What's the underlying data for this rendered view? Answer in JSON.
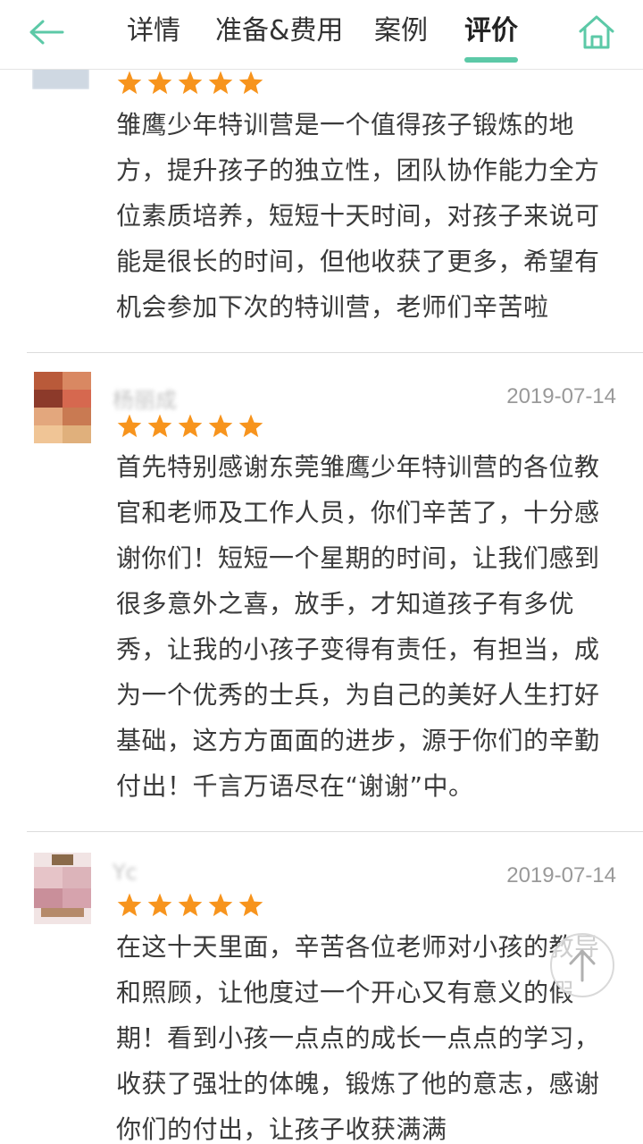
{
  "header": {
    "back_icon": "arrow-left-icon",
    "home_icon": "home-icon",
    "accent_color": "#5cc9a7",
    "tabs": [
      {
        "label": "详情",
        "active": false
      },
      {
        "label": "准备&费用",
        "active": false
      },
      {
        "label": "案例",
        "active": false
      },
      {
        "label": "评价",
        "active": true
      }
    ]
  },
  "reviews": [
    {
      "username": "",
      "date": "",
      "rating": 5,
      "text": "雏鹰少年特训营是一个值得孩子锻炼的地方，提升孩子的独立性，团队协作能力全方位素质培养，短短十天时间，对孩子来说可能是很长的时间，但他收获了更多，希望有机会参加下次的特训营，老师们辛苦啦"
    },
    {
      "username": "杨丽成",
      "date": "2019-07-14",
      "rating": 5,
      "text": "首先特别感谢东莞雏鹰少年特训营的各位教官和老师及工作人员，你们辛苦了，十分感谢你们！短短一个星期的时间，让我们感到很多意外之喜，放手，才知道孩子有多优秀，让我的小孩子变得有责任，有担当，成为一个优秀的士兵，为自己的美好人生打好基础，这方方面面的进步，源于你们的辛勤付出！千言万语尽在“谢谢”中。"
    },
    {
      "username": "Yc",
      "date": "2019-07-14",
      "rating": 5,
      "text": "在这十天里面，辛苦各位老师对小孩的教导和照顾，让他度过一个开心又有意义的假期！看到小孩一点点的成长一点点的学习，收获了强壮的体魄，锻炼了他的意志，感谢你们的付出，让孩子收获满满"
    }
  ],
  "star_color": "#f7941d",
  "back_to_top_icon": "arrow-up-icon"
}
